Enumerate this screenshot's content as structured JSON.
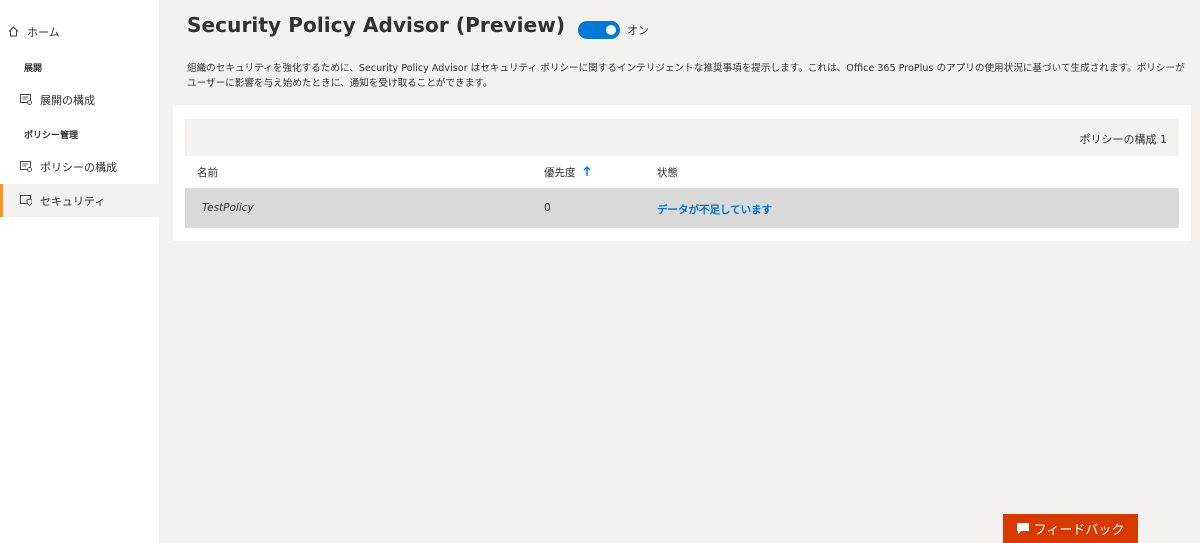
{
  "sidebar": {
    "home_label": "ホーム",
    "group_deploy": "展開",
    "deploy_config_label": "展開の構成",
    "group_policy": "ポリシー管理",
    "policy_config_label": "ポリシーの構成",
    "security_label": "セキュリティ"
  },
  "header": {
    "title": "Security Policy Advisor (Preview)",
    "toggle_label": "オン",
    "toggle_on": true
  },
  "description": "組織のセキュリティを強化するために、Security Policy Advisor はセキュリティ ポリシーに関するインテリジェントな推奨事項を提示します。これは、Office 365 ProPlus のアプリの使用状況に基づいて生成されます。ポリシーがユーザーに影響を与え始めたときに、通知を受け取ることができます。",
  "table": {
    "count_label": "ポリシーの構成 1",
    "columns": {
      "name": "名前",
      "priority": "優先度",
      "status": "状態"
    },
    "rows": [
      {
        "name": "TestPolicy",
        "priority": "0",
        "status": "データが不足しています"
      }
    ]
  },
  "feedback": {
    "label": "フィードバック"
  },
  "colors": {
    "accent": "#0078d4",
    "selected_indicator": "#f7941d",
    "feedback_bg": "#d83b01"
  }
}
